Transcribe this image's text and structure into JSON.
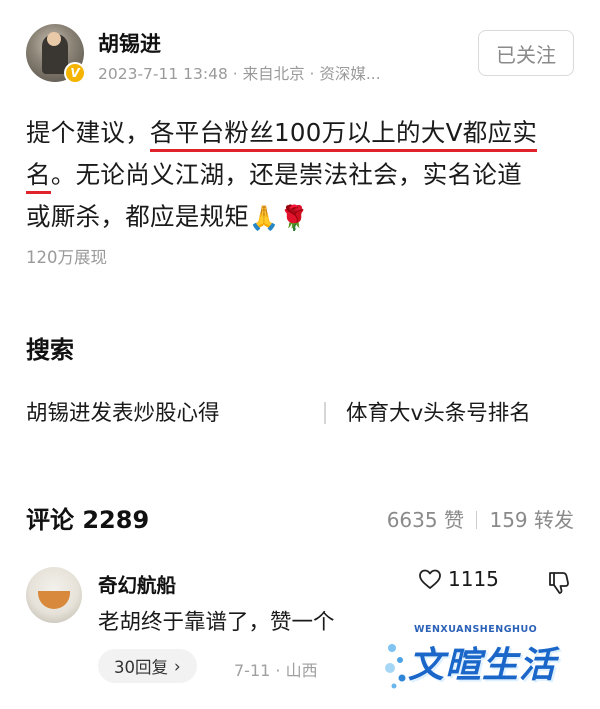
{
  "post": {
    "author": "胡锡进",
    "badge": "V",
    "meta": "2023-7-11 13:48 · 来自北京 · 资深媒...",
    "follow_label": "已关注",
    "text_line1_plain": "提个建议，",
    "text_line1_hl": "各平台粉丝100万以上的大V都应实",
    "text_line2_hl": "名",
    "text_line2_plain": "。无论尚义江湖，还是崇法社会，实名论道",
    "text_line3": "或厮杀，都应是规矩",
    "emojis": [
      "🙏",
      "🌹"
    ],
    "views": "120万展现"
  },
  "search": {
    "title": "搜索",
    "items": [
      "胡锡进发表炒股心得",
      "体育大v头条号排名"
    ]
  },
  "comments": {
    "title": "评论 2289",
    "likes": "6635 赞",
    "reposts": "159 转发"
  },
  "comment": {
    "name": "奇幻航船",
    "like_count": "1115",
    "text": "老胡终于靠谱了，赞一个",
    "replies": "30回复",
    "replies_chevron": "›",
    "meta": "7-11 · 山西"
  },
  "watermark": {
    "small": "WENXUANSHENGHUO",
    "main": "文暄生活"
  },
  "colors": {
    "highlight_underline": "#e0232b",
    "watermark_blue": "#1b67c9",
    "verified_badge": "#f4b400"
  },
  "icons": {
    "like": "heart-outline-icon",
    "dislike": "thumbs-down-icon",
    "verified": "verified-v-badge-icon"
  }
}
